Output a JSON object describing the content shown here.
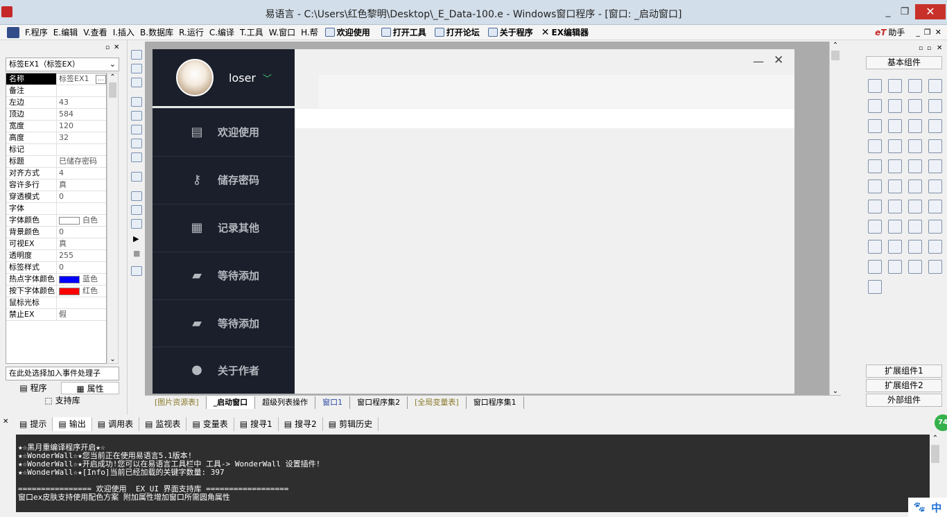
{
  "window": {
    "title": "易语言 - C:\\Users\\红色黎明\\Desktop\\_E_Data-100.e - Windows窗口程序 - [窗口: _启动窗口]",
    "minimize": "_",
    "restore": "❐",
    "close": "✕"
  },
  "menu": [
    "F.程序",
    "E.编辑",
    "V.查看",
    "I.插入",
    "B.数据库",
    "R.运行",
    "C.编译",
    "T.工具",
    "W.窗口",
    "H.帮"
  ],
  "toolbar": {
    "welcome": "欢迎使用",
    "open_tools": "打开工具",
    "open_forum": "打开论坛",
    "about": "关于程序",
    "ex_editor": "EX编辑器",
    "helper": "助手",
    "helper_prefix": "eT"
  },
  "properties": {
    "object_combo": "标签EX1（标签EX）",
    "rows": [
      {
        "name": "名称",
        "value": "标签EX1",
        "selected": true
      },
      {
        "name": "备注",
        "value": ""
      },
      {
        "name": "左边",
        "value": "43"
      },
      {
        "name": "顶边",
        "value": "584"
      },
      {
        "name": "宽度",
        "value": "120"
      },
      {
        "name": "高度",
        "value": "32"
      },
      {
        "name": "标记",
        "value": ""
      },
      {
        "name": "标题",
        "value": "已储存密码"
      },
      {
        "name": "对齐方式",
        "value": "4"
      },
      {
        "name": "容许多行",
        "value": "真"
      },
      {
        "name": "穿透模式",
        "value": "0"
      },
      {
        "name": "字体",
        "value": ""
      },
      {
        "name": "字体颜色",
        "value": "白色",
        "color": "#ffffff"
      },
      {
        "name": "背景颜色",
        "value": "0"
      },
      {
        "name": "可视EX",
        "value": "真"
      },
      {
        "name": "透明度",
        "value": "255"
      },
      {
        "name": "标签样式",
        "value": "0"
      },
      {
        "name": "热点字体颜色",
        "value": "蓝色",
        "color": "#0000ff"
      },
      {
        "name": "按下字体颜色",
        "value": "红色",
        "color": "#ff0000"
      },
      {
        "name": "鼠标光标",
        "value": ""
      },
      {
        "name": "禁止EX",
        "value": "假"
      }
    ],
    "event_combo": "在此处选择加入事件处理子",
    "tab_program": "程序",
    "tab_properties": "属性",
    "tab_support": "支持库"
  },
  "designer": {
    "username": "loser",
    "min_label": "—",
    "close_label": "✕",
    "nav": [
      {
        "label": "欢迎使用",
        "icon": "▤"
      },
      {
        "label": "储存密码",
        "icon": "⚷"
      },
      {
        "label": "记录其他",
        "icon": "▦"
      },
      {
        "label": "等待添加",
        "icon": "▰"
      },
      {
        "label": "等待添加",
        "icon": "▰"
      },
      {
        "label": "关于作者",
        "icon": "●"
      }
    ]
  },
  "file_tabs": [
    "[图片资源表]",
    "_启动窗口",
    "超级列表操作",
    "窗口1",
    "窗口程序集2",
    "[全局变量表]",
    "窗口程序集1"
  ],
  "components": {
    "basic": "基本组件",
    "ext1": "扩展组件1",
    "ext2": "扩展组件2",
    "external": "外部组件"
  },
  "output_tabs": [
    "提示",
    "输出",
    "调用表",
    "监视表",
    "变量表",
    "搜寻1",
    "搜寻2",
    "剪辑历史"
  ],
  "output_lines": [
    "★☆黑月重编译程序开启★☆",
    "★☆WonderWall☆★您当前正在使用易语言5.1版本!",
    "★☆WonderWall☆★开启成功!您可以在易语言工具栏中 工具-> WonderWall 设置插件!",
    "★☆WonderWall☆★[Info]当前已经加载的关键字数量: 397",
    "",
    "================ 欢迎使用  EX_UI 界面支持库 ==================",
    "窗口ex皮肤支持使用配色方案 附加属性增加窗口所需圆角属性"
  ],
  "ime": {
    "mode": "中"
  },
  "badge": "74"
}
